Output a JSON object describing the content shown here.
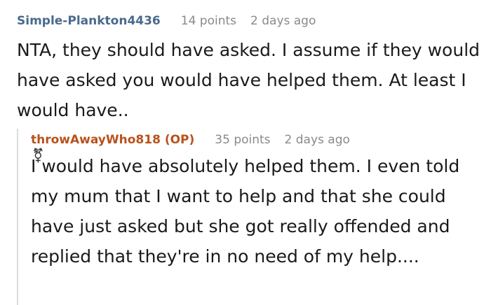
{
  "comments": [
    {
      "author": "Simple-Plankton4436",
      "points": "14 points",
      "time": "2 days ago",
      "text": "NTA, they should have asked. I assume if they would have asked you would have helped them. At least I would have.."
    },
    {
      "author": "throwAwayWho818 (OP)",
      "points": "35 points",
      "time": "2 days ago",
      "text": "I would have absolutely helped them. I even told my mum that I want to help and that she could have just asked but she got really offended and replied that they're in no need of my help...."
    }
  ],
  "reply_icon": "⚧",
  "colors": {
    "user_author": "#4a6a8c",
    "op_author": "#b8521c",
    "meta_text": "#8a8a8a",
    "thread_line": "#dcdcdc"
  },
  "icons": {
    "reply_icon_name": "gender-symbol-icon"
  }
}
